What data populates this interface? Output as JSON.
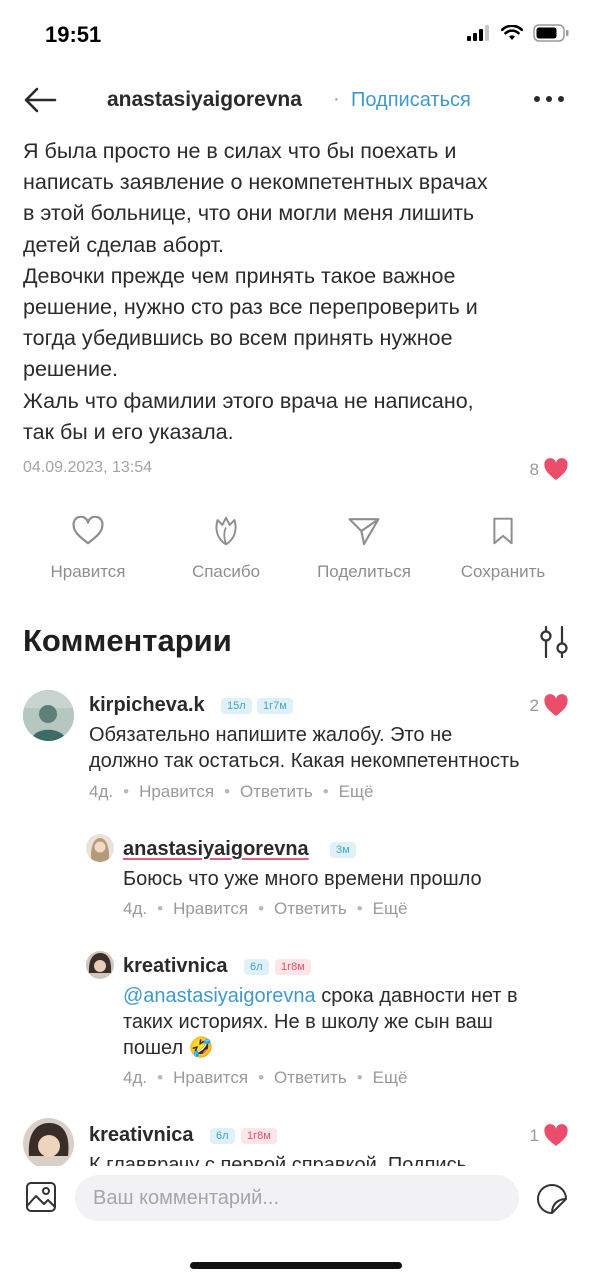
{
  "status": {
    "time": "19:51"
  },
  "nav": {
    "author": "anastasiyaigorevna",
    "dot": "·",
    "subscribe_label": "Подписаться"
  },
  "post": {
    "text": "Я была просто не в силах что бы поехать и\nнаписать заявление о некомпетентных врачах\nв этой больнице, что они могли меня лишить\nдетей сделав аборт.\nДевочки прежде чем принять такое важное\nрешение, нужно сто раз все перепроверить и\nтогда убедившись во всем принять нужное\nрешение.\nЖаль что фамилии этого врача не написано,\nтак бы и его указала.",
    "date": "04.09.2023, 13:54",
    "likes": "8"
  },
  "actions": {
    "like": "Нравится",
    "thanks": "Спасибо",
    "share": "Поделиться",
    "save": "Сохранить"
  },
  "comments_title": "Комментарии",
  "comments": [
    {
      "user": "kirpicheva.k",
      "badge1": "15л",
      "badge2": "1г7м",
      "text": "Обязательно напишите жалобу. Это не\nдолжно так остаться. Какая некомпетентность",
      "likes": "2",
      "age": "4д.",
      "like": "Нравится",
      "reply": "Ответить",
      "more": "Ещё"
    },
    {
      "user": "anastasiyaigorevna",
      "badge1": "3м",
      "text": "Боюсь что уже много времени прошло",
      "age": "4д.",
      "like": "Нравится",
      "reply": "Ответить",
      "more": "Ещё"
    },
    {
      "user": "kreativnica",
      "badge1": "6л",
      "badge2": "1г8м",
      "mention": "@anastasiyaigorevna",
      "text": " срока давности нет в\nтаких историях. Не в школу же сын ваш\nпошел 🤣",
      "age": "4д.",
      "like": "Нравится",
      "reply": "Ответить",
      "more": "Ещё"
    },
    {
      "user": "kreativnica",
      "badge1": "6л",
      "badge2": "1г8м",
      "likes": "1",
      "text": "К главврачу с первой справкой. Подпись"
    }
  ],
  "composer": {
    "placeholder": "Ваш комментарий..."
  },
  "colors": {
    "accent": "#3d9ad1",
    "heart": "#ea4e6a",
    "muted": "#9a9a9a"
  },
  "icons": [
    "back-arrow-icon",
    "more-dots-icon",
    "heart-icon",
    "tulip-icon",
    "paper-plane-icon",
    "bookmark-icon",
    "filter-icon",
    "image-icon",
    "sticker-icon"
  ]
}
